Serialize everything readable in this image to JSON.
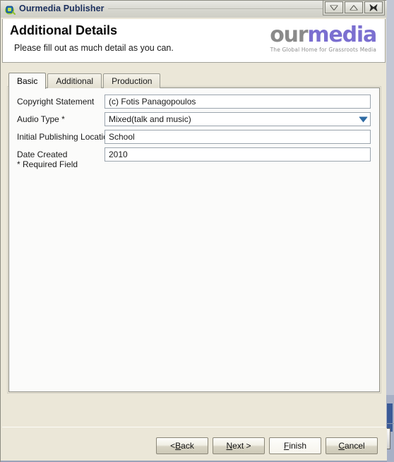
{
  "window": {
    "title": "Ourmedia Publisher",
    "app_icon": "ourmedia-app-icon",
    "controls": [
      {
        "name": "minimize",
        "icon": "chevron-down-icon"
      },
      {
        "name": "maximize",
        "icon": "chevron-up-icon"
      },
      {
        "name": "close",
        "icon": "close-x-icon"
      }
    ]
  },
  "header": {
    "title": "Additional Details",
    "subtitle": "Please fill out as much detail as you can.",
    "logo": {
      "part1": "our",
      "part2": "media",
      "tagline": "The Global Home for Grassroots Media",
      "color1": "#8a8a8a",
      "color2": "#7b6fd0"
    }
  },
  "tabs": [
    {
      "label": "Basic",
      "active": true
    },
    {
      "label": "Additional",
      "active": false
    },
    {
      "label": "Production",
      "active": false
    }
  ],
  "form": {
    "fields": [
      {
        "label": "Copyright Statement",
        "value": "(c) Fotis Panagopoulos",
        "type": "text",
        "required": false
      },
      {
        "label": "Audio Type *",
        "value": "Mixed(talk and music)",
        "type": "combobox",
        "required": true
      },
      {
        "label": "Initial Publishing Location",
        "value": "School",
        "type": "text",
        "required": false
      },
      {
        "label": "Date Created",
        "value": "2010",
        "type": "text",
        "required": false
      }
    ],
    "required_note": "* Required Field"
  },
  "buttons": [
    {
      "label": "< Back",
      "prefix": "< ",
      "accel": "B",
      "suffix": "ack",
      "name": "back-button",
      "primary": false
    },
    {
      "label": "Next >",
      "prefix": "",
      "accel": "N",
      "suffix": "ext >",
      "name": "next-button",
      "primary": false
    },
    {
      "label": "Finish",
      "prefix": "",
      "accel": "F",
      "suffix": "inish",
      "name": "finish-button",
      "primary": true
    },
    {
      "label": "Cancel",
      "prefix": "",
      "accel": "C",
      "suffix": "ancel",
      "name": "cancel-button",
      "primary": false
    }
  ],
  "colors": {
    "window_chrome": "#ebe7d8",
    "panel": "#fbfbfa",
    "title_text": "#1b2f5e",
    "combo_arrow": "#2f6ba3",
    "desktop": "#b9bfcf"
  }
}
